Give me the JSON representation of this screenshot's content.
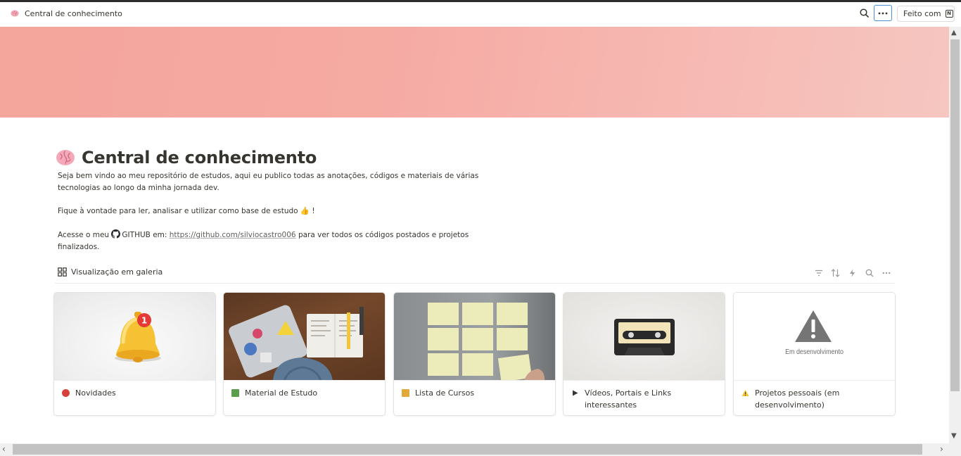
{
  "topbar": {
    "breadcrumb": "Central de conhecimento",
    "made_with": "Feito com",
    "notion_mark": "N"
  },
  "page": {
    "title": "Central de conhecimento",
    "intro_line": "Seja bem vindo ao meu repositório de estudos, aqui eu publico todas as anotações, códigos e materiais de várias tecnologias ao longo da minha jornada dev.",
    "invite_line": "Fique à vontade para ler, analisar e utilizar como base de estudo 👍 !",
    "github_prefix": "Acesse o meu",
    "github_label": "GITHUB em:",
    "github_url": "https://github.com/silviocastro006",
    "github_suffix": "para ver todos os códigos postados e projetos finalizados."
  },
  "gallery": {
    "view_label": "Visualização em galeria",
    "cards": [
      {
        "label": "Novidades",
        "icon": "red-circle-icon"
      },
      {
        "label": "Material de Estudo",
        "icon": "green-book-icon"
      },
      {
        "label": "Lista de Cursos",
        "icon": "memo-icon"
      },
      {
        "label": "Vídeos, Portais e Links interessantes",
        "icon": "play-icon"
      },
      {
        "label": "Projetos pessoais (em desenvolvimento)",
        "icon": "warning-icon",
        "cover_text": "Em desenvolvimento"
      }
    ]
  },
  "notification_count": "1",
  "colors": {
    "cover_start": "#f4a59c",
    "cover_end": "#f6c6c0",
    "text": "#37352f",
    "focus_ring": "#4a90d9"
  }
}
